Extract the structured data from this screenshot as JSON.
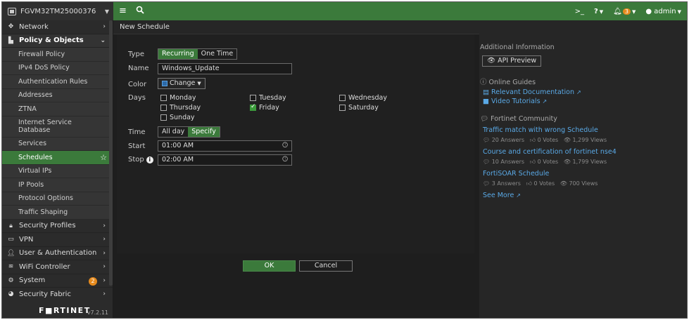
{
  "topbar": {
    "device_name": "FGVM32TM25000376",
    "menu_icon": "hamburger-icon",
    "search_icon": "search-icon",
    "cli_label": ">_",
    "help_label": "?",
    "notifications_count": "3",
    "user_label": "admin"
  },
  "sidebar": {
    "items": [
      {
        "label": "Network",
        "icon": "network-icon"
      },
      {
        "label": "Policy & Objects",
        "icon": "policy-icon"
      }
    ],
    "sub_items": [
      "Firewall Policy",
      "IPv4 DoS Policy",
      "Authentication Rules",
      "Addresses",
      "ZTNA",
      "Internet Service Database",
      "Services",
      "Schedules",
      "Virtual IPs",
      "IP Pools",
      "Protocol Options",
      "Traffic Shaping"
    ],
    "bottom_items": [
      {
        "label": "Security Profiles"
      },
      {
        "label": "VPN"
      },
      {
        "label": "User & Authentication"
      },
      {
        "label": "WiFi Controller"
      },
      {
        "label": "System",
        "badge": "2"
      },
      {
        "label": "Security Fabric"
      }
    ],
    "brand": "F■RTINET",
    "version": "v7.2.11"
  },
  "page": {
    "title": "New Schedule"
  },
  "form": {
    "type_label": "Type",
    "type_options": [
      "Recurring",
      "One Time"
    ],
    "name_label": "Name",
    "name_value": "Windows_Update",
    "color_label": "Color",
    "color_button": "Change",
    "days_label": "Days",
    "days": [
      {
        "label": "Monday",
        "checked": false
      },
      {
        "label": "Tuesday",
        "checked": false
      },
      {
        "label": "Wednesday",
        "checked": false
      },
      {
        "label": "Thursday",
        "checked": false
      },
      {
        "label": "Friday",
        "checked": true
      },
      {
        "label": "Saturday",
        "checked": false
      },
      {
        "label": "Sunday",
        "checked": false
      }
    ],
    "time_label": "Time",
    "time_options": [
      "All day",
      "Specify"
    ],
    "start_label": "Start",
    "start_value": "01:00 AM",
    "stop_label": "Stop",
    "stop_value": "02:00 AM",
    "ok_label": "OK",
    "cancel_label": "Cancel"
  },
  "side": {
    "additional_info": "Additional Information",
    "api_preview": "API Preview",
    "online_guides": "Online Guides",
    "relevant_docs": "Relevant Documentation",
    "video_tutorials": "Video Tutorials",
    "community": "Fortinet Community",
    "posts": [
      {
        "title": "Traffic match with wrong Schedule",
        "answers": "20 Answers",
        "votes": "0 Votes",
        "views": "1,299 Views"
      },
      {
        "title": "Course and certification of fortinet nse4",
        "answers": "10 Answers",
        "votes": "0 Votes",
        "views": "1,799 Views"
      },
      {
        "title": "FortiSOAR Schedule",
        "answers": "3 Answers",
        "votes": "0 Votes",
        "views": "700 Views"
      }
    ],
    "see_more": "See More"
  },
  "colors": {
    "accent_green": "#3b7a3b",
    "link_blue": "#5aa9e6",
    "badge_orange": "#e68a1d"
  }
}
